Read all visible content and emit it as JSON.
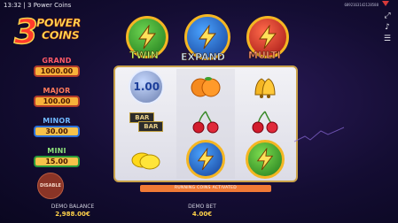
{
  "status_bar": {
    "time": "13:32",
    "title": "3 Power Coins",
    "session_id": "6892163142128588"
  },
  "logo": {
    "number": "3",
    "line1": "Power",
    "line2": "Coins"
  },
  "jackpots": [
    {
      "name": "GRAND",
      "value": "1000.00"
    },
    {
      "name": "MAJOR",
      "value": "100.00"
    },
    {
      "name": "MINOR",
      "value": "30.00"
    },
    {
      "name": "MINI",
      "value": "15.00"
    }
  ],
  "power_coins": [
    {
      "label": "TWIN",
      "color": "#2f9a2a"
    },
    {
      "label": "EXPAND",
      "color": "#1f5fd0"
    },
    {
      "label": "MULTI",
      "color": "#d02a1c"
    }
  ],
  "reels": {
    "rows": [
      [
        "coin-1.00",
        "orange",
        "bell"
      ],
      [
        "bar",
        "cherry",
        "cherry"
      ],
      [
        "lemon",
        "power-coin-blue",
        "power-coin-green"
      ]
    ],
    "coin_value": "1.00",
    "bar_label": "BAR"
  },
  "respin_banner": "RUNNING COINS ACTIVATED",
  "disable_button": "DISABLE",
  "balance": {
    "label": "DEMO BALANCE",
    "value": "2,988.00€"
  },
  "bet": {
    "label": "DEMO BET",
    "value": "4.00€"
  },
  "icons": [
    "fullscreen-icon",
    "sound-icon",
    "menu-icon"
  ],
  "colors": {
    "background": "#140d33",
    "accent_gold": "#f4b623",
    "banner": "#f07a36"
  }
}
